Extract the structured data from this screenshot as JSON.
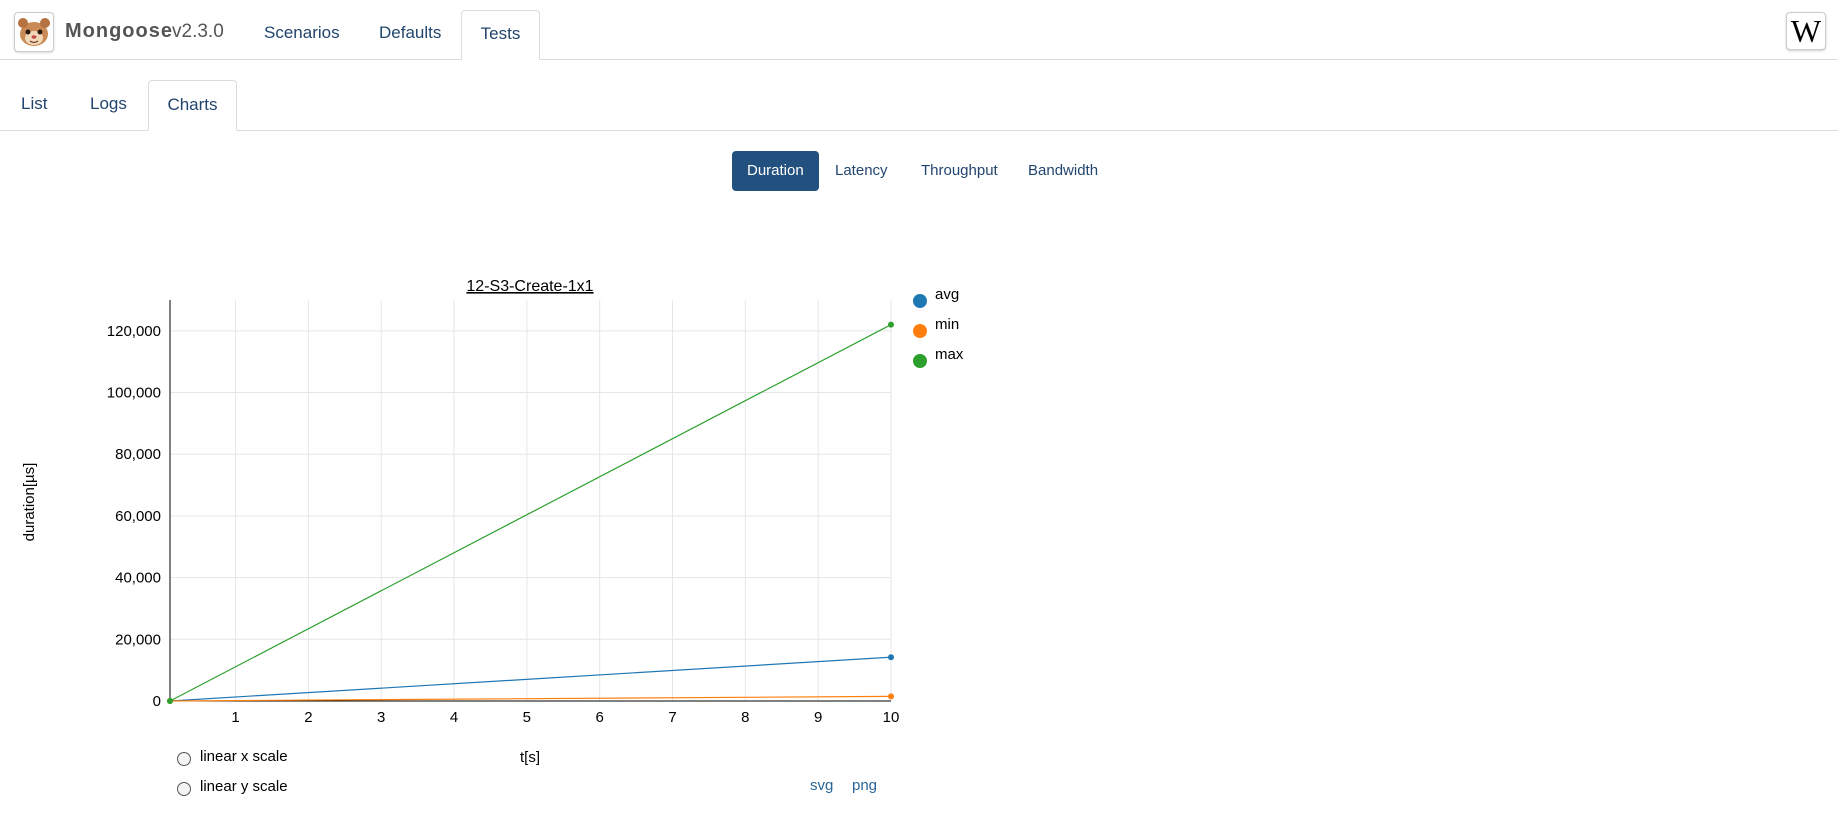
{
  "app": {
    "brand": "Mongoose",
    "version": "v2.3.0",
    "logo_icon": "ferret-logo-icon"
  },
  "nav": {
    "tabs": [
      {
        "label": "Scenarios",
        "active": false
      },
      {
        "label": "Defaults",
        "active": false
      },
      {
        "label": "Tests",
        "active": true
      }
    ]
  },
  "wiki": {
    "label": "W"
  },
  "subnav": {
    "tabs": [
      {
        "label": "List",
        "active": false
      },
      {
        "label": "Logs",
        "active": false
      },
      {
        "label": "Charts",
        "active": true
      }
    ]
  },
  "metrics": {
    "tabs": [
      {
        "label": "Duration",
        "active": true
      },
      {
        "label": "Latency",
        "active": false
      },
      {
        "label": "Throughput",
        "active": false
      },
      {
        "label": "Bandwidth",
        "active": false
      }
    ]
  },
  "options": {
    "linear_x": "linear x scale",
    "linear_y": "linear y scale"
  },
  "export": {
    "svg": "svg",
    "png": "png"
  },
  "colors": {
    "accent": "#22507f",
    "link": "#22456e",
    "avg": "#1f77b4",
    "min": "#ff7f0e",
    "max": "#2ca02c"
  },
  "chart_data": {
    "type": "line",
    "title": "12-S3-Create-1x1",
    "xlabel": "t[s]",
    "ylabel": "duration[µs]",
    "xlim": [
      0.1,
      10
    ],
    "ylim": [
      0,
      130000
    ],
    "x_ticks": [
      "1",
      "2",
      "3",
      "4",
      "5",
      "6",
      "7",
      "8",
      "9",
      "10"
    ],
    "y_ticks": [
      "0",
      "20,000",
      "40,000",
      "60,000",
      "80,000",
      "100,000",
      "120,000"
    ],
    "grid": true,
    "legend_position": "right",
    "series": [
      {
        "name": "avg",
        "x": [
          0.1,
          10
        ],
        "y": [
          0,
          14200
        ]
      },
      {
        "name": "min",
        "x": [
          0.1,
          10
        ],
        "y": [
          0,
          1500
        ]
      },
      {
        "name": "max",
        "x": [
          0.1,
          10
        ],
        "y": [
          0,
          122000
        ]
      }
    ]
  }
}
